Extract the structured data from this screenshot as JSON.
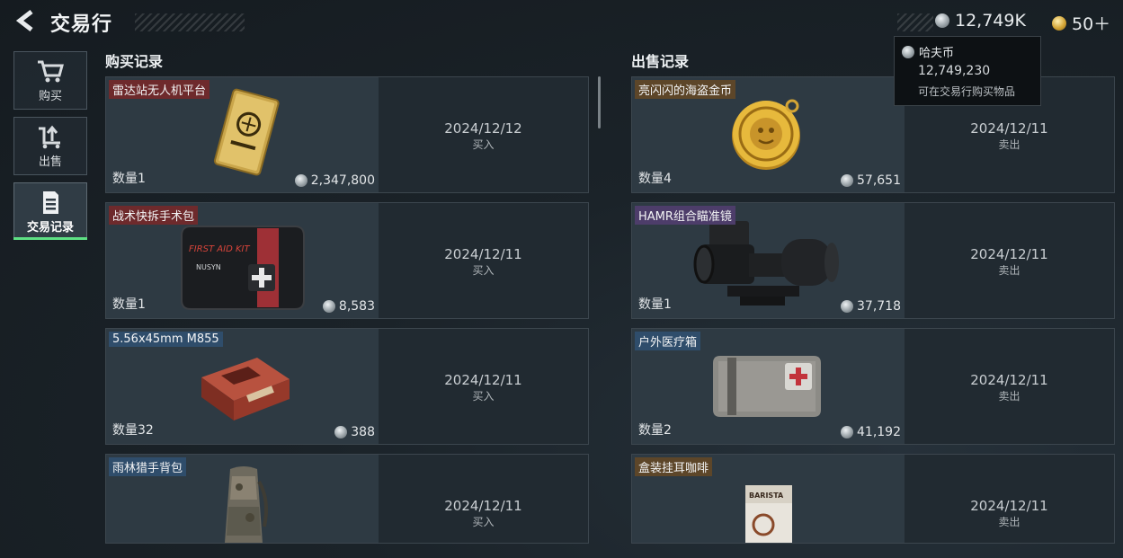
{
  "header": {
    "title": "交易行",
    "balance": "12,749K",
    "gold": "50＋"
  },
  "tooltip": {
    "currency_name": "哈夫币",
    "amount": "12,749,230",
    "description": "可在交易行购买物品"
  },
  "sidebar": {
    "items": [
      {
        "label": "购买",
        "icon": "cart-icon",
        "active": false
      },
      {
        "label": "出售",
        "icon": "sell-icon",
        "active": false
      },
      {
        "label": "交易记录",
        "icon": "record-icon",
        "active": true
      }
    ]
  },
  "buy_records": {
    "title": "购买记录",
    "items": [
      {
        "name": "雷达站无人机平台",
        "qty": "数量1",
        "price": "2,347,800",
        "date": "2024/12/12",
        "action": "买入",
        "rarity": "red"
      },
      {
        "name": "战术快拆手术包",
        "qty": "数量1",
        "price": "8,583",
        "date": "2024/12/11",
        "action": "买入",
        "rarity": "red",
        "art_text": "FIRST AID KIT",
        "art_brand": "NUSYN"
      },
      {
        "name": "5.56x45mm M855",
        "qty": "数量32",
        "price": "388",
        "date": "2024/12/11",
        "action": "买入",
        "rarity": "blue"
      },
      {
        "name": "雨林猎手背包",
        "qty": "",
        "price": "",
        "date": "2024/12/11",
        "action": "买入",
        "rarity": "blue"
      }
    ]
  },
  "sell_records": {
    "title": "出售记录",
    "items": [
      {
        "name": "亮闪闪的海盗金币",
        "qty": "数量4",
        "price": "57,651",
        "date": "2024/12/11",
        "action": "卖出",
        "rarity": "amber"
      },
      {
        "name": "HAMR组合瞄准镜",
        "qty": "数量1",
        "price": "37,718",
        "date": "2024/12/11",
        "action": "卖出",
        "rarity": "purple"
      },
      {
        "name": "户外医疗箱",
        "qty": "数量2",
        "price": "41,192",
        "date": "2024/12/11",
        "action": "卖出",
        "rarity": "blue"
      },
      {
        "name": "盒装挂耳咖啡",
        "qty": "",
        "price": "",
        "date": "2024/12/11",
        "action": "卖出",
        "rarity": "amber",
        "art_text": "BARISTA"
      }
    ]
  },
  "colors": {
    "accent_green": "#5ee084",
    "rarity_red": "#6e2a2c",
    "rarity_blue": "#2f4d6b",
    "rarity_purple": "#4d3d6a",
    "rarity_amber": "#5d4629"
  }
}
